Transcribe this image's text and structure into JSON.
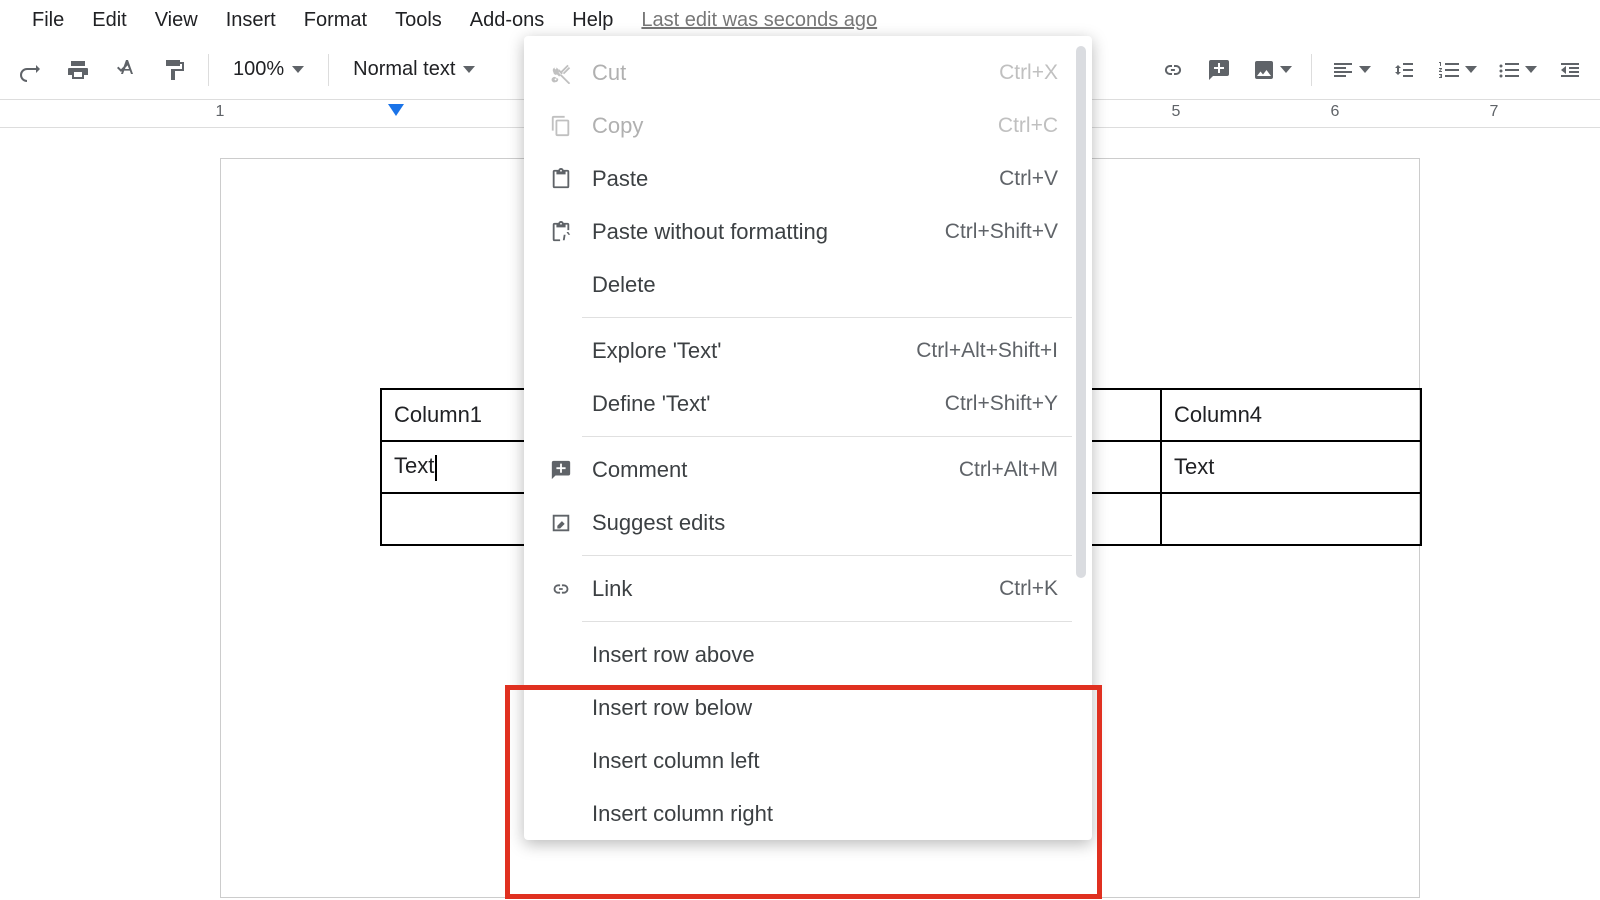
{
  "menubar": {
    "file": "File",
    "edit": "Edit",
    "view": "View",
    "insert": "Insert",
    "format": "Format",
    "tools": "Tools",
    "addons": "Add-ons",
    "help": "Help",
    "last_edit": "Last edit was seconds ago"
  },
  "toolbar": {
    "zoom": "100%",
    "paragraph_style": "Normal text"
  },
  "ruler": {
    "n1": "1",
    "n5": "5",
    "n6": "6",
    "n7": "7"
  },
  "table": {
    "r0c0": "Column1",
    "r0c3": "Column4",
    "r1c0": "Text",
    "r1c3": "Text"
  },
  "context_menu": {
    "cut": {
      "label": "Cut",
      "shortcut": "Ctrl+X"
    },
    "copy": {
      "label": "Copy",
      "shortcut": "Ctrl+C"
    },
    "paste": {
      "label": "Paste",
      "shortcut": "Ctrl+V"
    },
    "paste_plain": {
      "label": "Paste without formatting",
      "shortcut": "Ctrl+Shift+V"
    },
    "delete": {
      "label": "Delete"
    },
    "explore": {
      "label": "Explore 'Text'",
      "shortcut": "Ctrl+Alt+Shift+I"
    },
    "define": {
      "label": "Define 'Text'",
      "shortcut": "Ctrl+Shift+Y"
    },
    "comment": {
      "label": "Comment",
      "shortcut": "Ctrl+Alt+M"
    },
    "suggest": {
      "label": "Suggest edits"
    },
    "link": {
      "label": "Link",
      "shortcut": "Ctrl+K"
    },
    "insert_row_above": {
      "label": "Insert row above"
    },
    "insert_row_below": {
      "label": "Insert row below"
    },
    "insert_col_left": {
      "label": "Insert column left"
    },
    "insert_col_right": {
      "label": "Insert column right"
    }
  }
}
